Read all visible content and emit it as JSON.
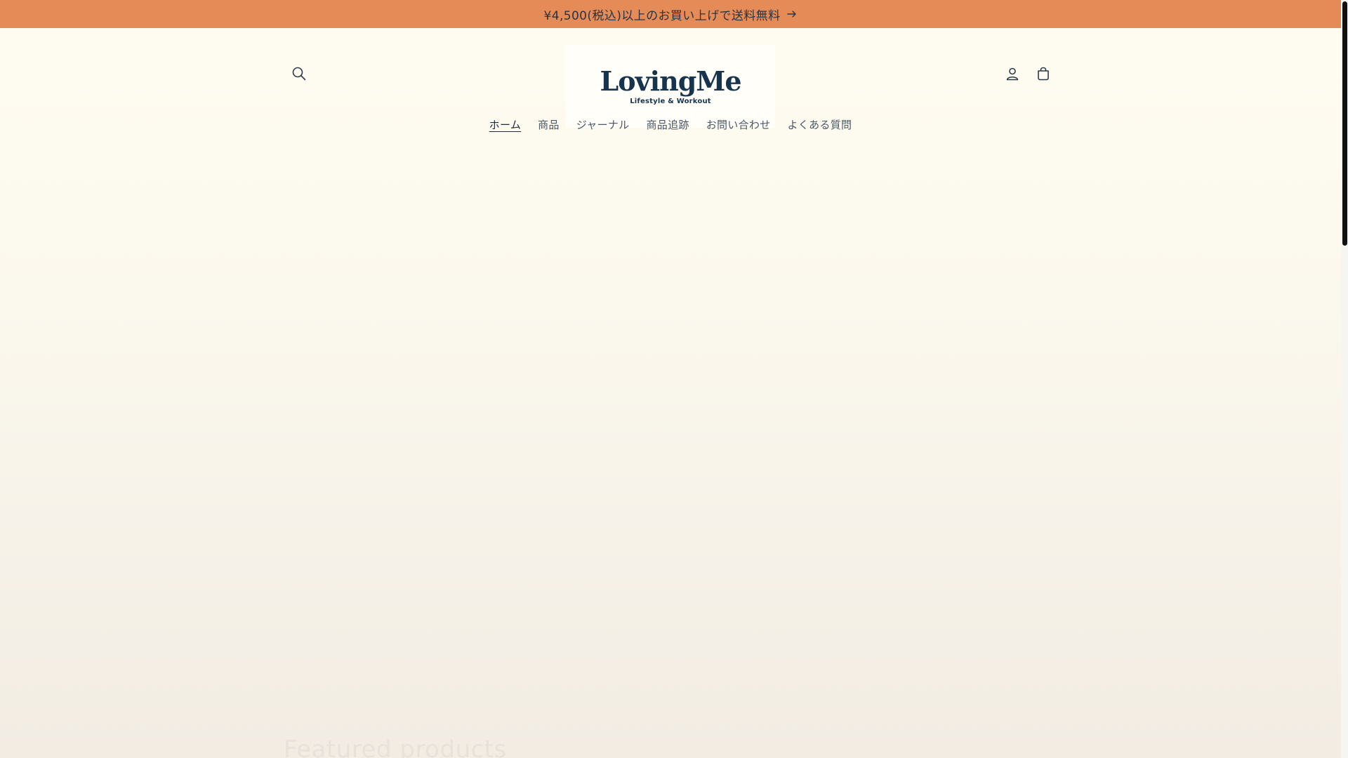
{
  "announcement": {
    "text": "¥4,500(税込)以上のお買い上げで送料無料",
    "arrow_icon": "arrow-right-icon"
  },
  "header": {
    "logo": {
      "wordmark": "LovingMe",
      "tagline": "Lifestyle & Workout"
    },
    "icons": {
      "search": "search-icon",
      "account": "user-icon",
      "cart": "cart-icon"
    }
  },
  "nav": {
    "items": [
      {
        "label": "ホーム",
        "active": true
      },
      {
        "label": "商品",
        "active": false
      },
      {
        "label": "ジャーナル",
        "active": false
      },
      {
        "label": "商品追跡",
        "active": false
      },
      {
        "label": "お問い合わせ",
        "active": false
      },
      {
        "label": "よくある質問",
        "active": false
      }
    ]
  },
  "section": {
    "heading": "Featured products"
  },
  "colors": {
    "announcement_bg": "#e58b57",
    "brand_navy": "#17344f",
    "page_bg_top": "#fffcf0",
    "page_bg_bottom": "#f2ece3"
  }
}
